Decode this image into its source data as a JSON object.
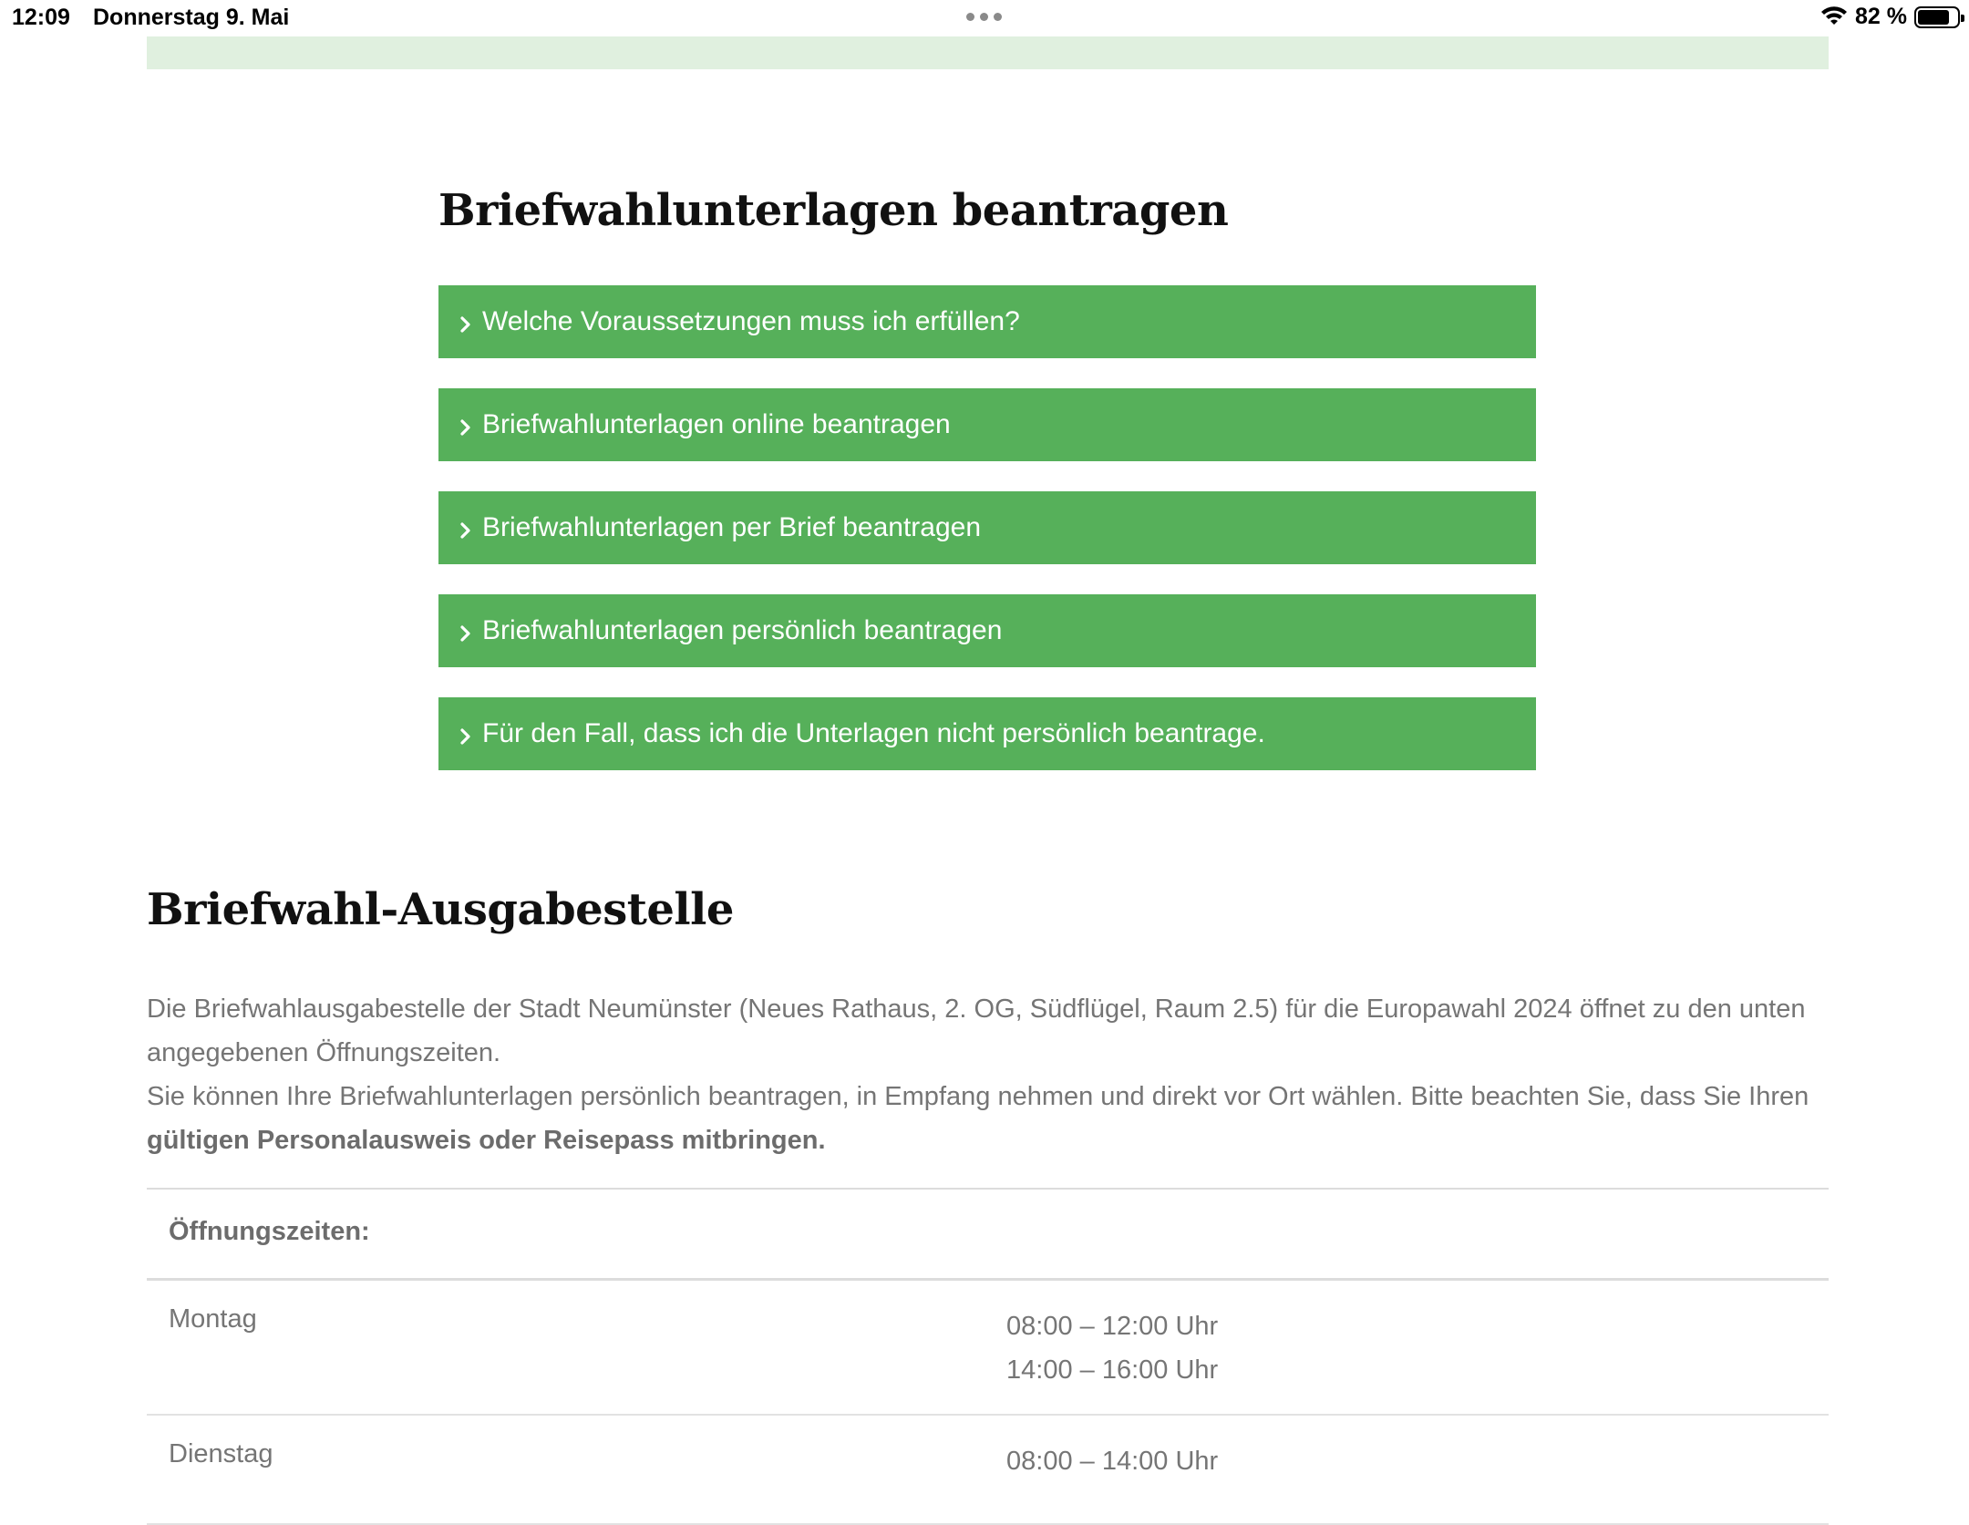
{
  "status_bar": {
    "time": "12:09",
    "date": "Donnerstag 9. Mai",
    "battery": "82 %",
    "battery_level": 0.82
  },
  "sections": {
    "antrag_title": "Briefwahlunterlagen beantragen",
    "accordion": [
      {
        "label": "Welche Voraussetzungen muss ich erfüllen?"
      },
      {
        "label": "Briefwahlunterlagen online beantragen"
      },
      {
        "label": "Briefwahlunterlagen per Brief beantragen"
      },
      {
        "label": "Briefwahlunterlagen persönlich beantragen"
      },
      {
        "label": "Für den Fall, dass ich die Unterlagen nicht persönlich beantrage."
      }
    ],
    "ausgabe_title": "Briefwahl-Ausgabestelle",
    "paragraph_1": "Die Briefwahlausgabestelle der Stadt Neumünster (Neues Rathaus, 2. OG, Südflügel, Raum 2.5) für die Europawahl 2024 öffnet zu den unten angegebenen Öffnungszeiten.",
    "paragraph_2_start": "Sie können Ihre Briefwahlunterlagen persönlich beantragen, in Empfang nehmen und  direkt vor Ort wählen. Bitte beachten Sie, dass Sie Ihren ",
    "paragraph_2_bold": "gültigen Personalausweis oder Reisepass mitbringen."
  },
  "hours_table": {
    "header": "Öffnungszeiten:",
    "rows": [
      {
        "day": "Montag",
        "times": [
          "08:00 – 12:00 Uhr",
          "14:00 – 16:00 Uhr"
        ]
      },
      {
        "day": "Dienstag",
        "times": [
          "08:00 – 14:00 Uhr"
        ]
      }
    ]
  },
  "colors": {
    "accent_green": "#56b05a",
    "banner_green": "#e0f0df",
    "text_gray": "#757575"
  }
}
